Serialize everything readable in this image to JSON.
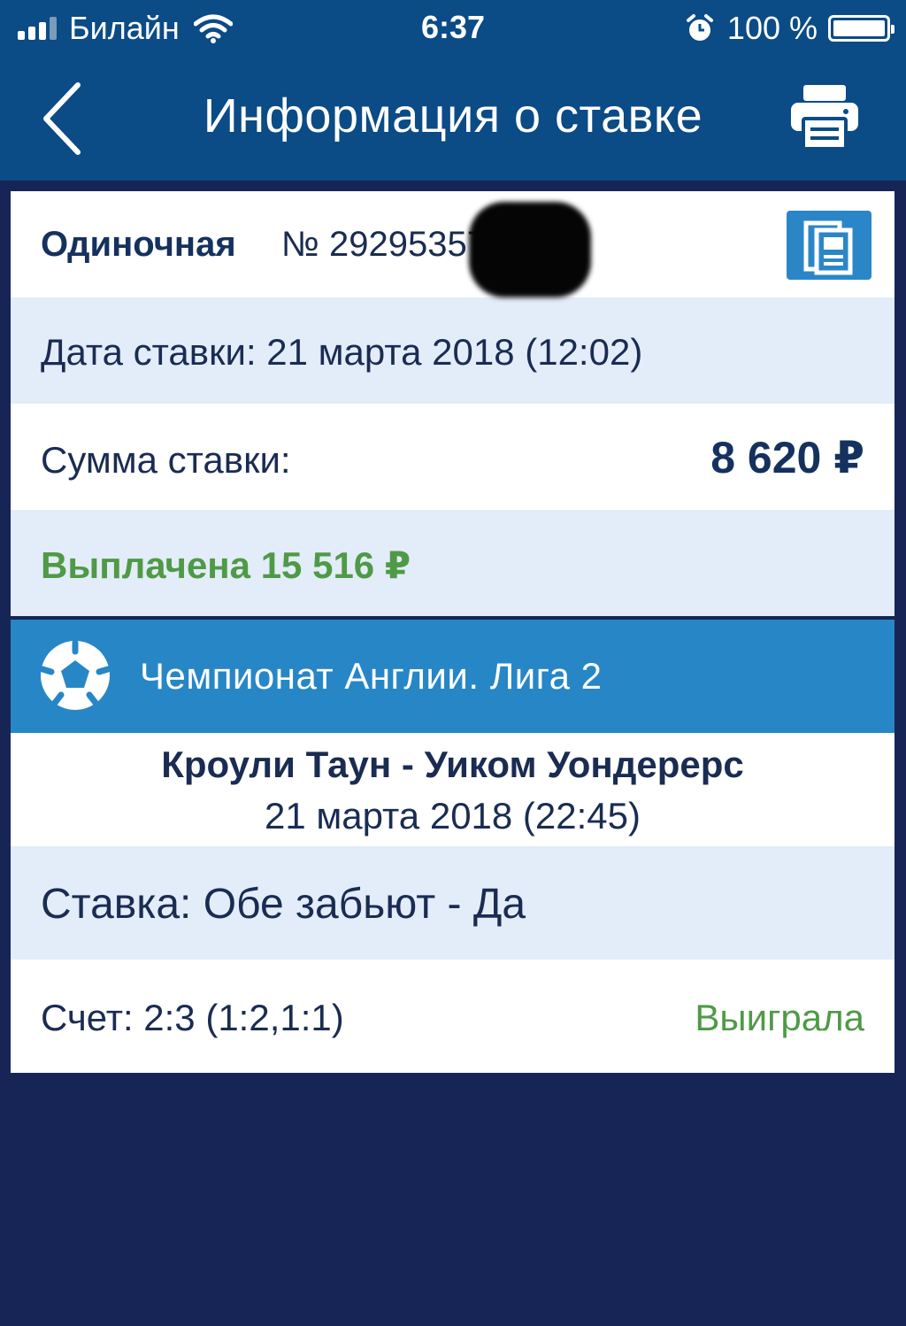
{
  "status_bar": {
    "carrier": "Билайн",
    "time": "6:37",
    "battery_percent": "100 %",
    "battery_level": 1.0,
    "icons": [
      "signal-bars-icon",
      "wifi-icon",
      "alarm-icon",
      "battery-icon"
    ]
  },
  "nav": {
    "title": "Информация о ставке",
    "back_icon": "chevron-left-icon",
    "print_icon": "printer-icon"
  },
  "bet": {
    "type": "Одиночная",
    "number": "№ 29295357773",
    "date_line": "Дата ставки: 21 марта 2018 (12:02)",
    "amount_label": "Сумма ставки:",
    "amount_value": "8 620 ₽",
    "payout": "Выплачена 15 516 ₽"
  },
  "event": {
    "league": "Чемпионат Англии. Лига 2",
    "match": "Кроули Таун - Уиком Уондерерс",
    "match_date": "21 марта 2018 (22:45)",
    "pick": "Ставка: Обе забьют - Да",
    "score": "Счет: 2:3 (1:2,1:1)",
    "result": "Выиграла"
  },
  "colors": {
    "header_bg": "#0b4b86",
    "page_bg": "#162556",
    "league_bar": "#2786c6",
    "light_row": "#e3ecf9",
    "win_green": "#4f9a46",
    "dark_text": "#1a2c52"
  }
}
